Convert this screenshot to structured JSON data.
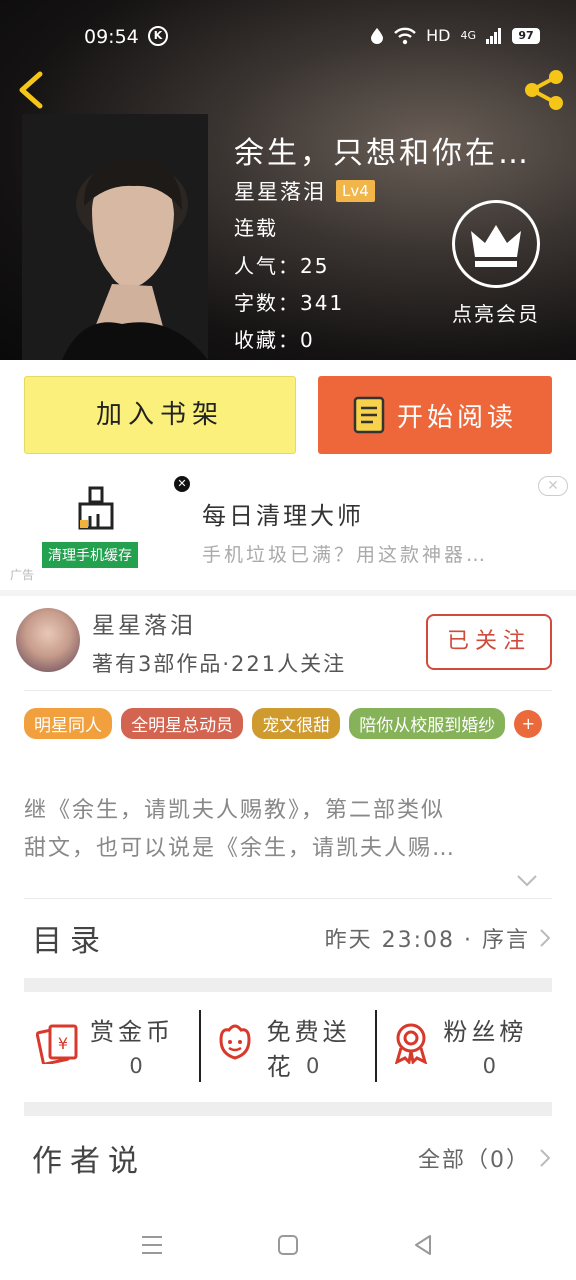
{
  "status_bar": {
    "time": "09:54",
    "network": "HD",
    "signal": "4G",
    "battery": "97"
  },
  "book": {
    "title": "余生，只想和你在…",
    "author": "星星落泪",
    "author_level": "Lv4",
    "status": "连载",
    "popularity": "人气：25",
    "word_count": "字数：341",
    "favorites": "收藏：0"
  },
  "vip": {
    "label": "点亮会员"
  },
  "actions": {
    "add_shelf": "加入书架",
    "start_read": "开始阅读"
  },
  "ad": {
    "tag": "清理手机缓存",
    "title": "每日清理大师",
    "subtitle": "手机垃圾已满？用这款神器…",
    "ad_mark": "广告"
  },
  "author_info": {
    "name": "星星落泪",
    "stats": "著有3部作品·221人关注",
    "follow_label": "已关注"
  },
  "tags": [
    {
      "label": "明星同人",
      "color": "#f2a03d"
    },
    {
      "label": "全明星总动员",
      "color": "#d36450"
    },
    {
      "label": "宠文很甜",
      "color": "#cf9a2e"
    },
    {
      "label": "陪你从校服到婚纱",
      "color": "#86b35a"
    }
  ],
  "tags_more": "+",
  "description": {
    "line1": "继《余生，请凯夫人赐教》，第二部类似",
    "line2": "甜文，也可以说是《余生，请凯夫人赐…"
  },
  "catalog": {
    "label": "目录",
    "info": "昨天 23:08 · 序言"
  },
  "rewards": [
    {
      "label": "赏金币",
      "count": "0"
    },
    {
      "label": "免费送花",
      "count": "0"
    },
    {
      "label": "粉丝榜",
      "count": "0"
    }
  ],
  "author_say": {
    "label": "作者说",
    "info": "全部（0）"
  },
  "colors": {
    "accent_orange": "#ed673a",
    "shelf_yellow": "#fbf07c",
    "follow_red": "#d14b3a"
  }
}
